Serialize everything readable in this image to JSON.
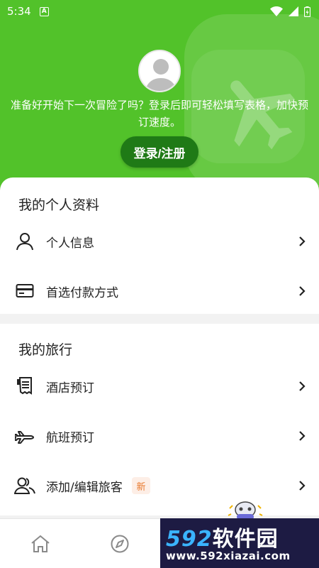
{
  "status_bar": {
    "time": "5:34",
    "notification_letter": "A"
  },
  "hero": {
    "promo_text": "准备好开始下一次冒险了吗？登录后即可轻松填写表格，加快预订速度。",
    "login_button": "登录/注册"
  },
  "profile_section": {
    "title": "我的个人资料",
    "items": [
      {
        "label": "个人信息",
        "icon": "person-icon"
      },
      {
        "label": "首选付款方式",
        "icon": "credit-card-icon"
      }
    ]
  },
  "trips_section": {
    "title": "我的旅行",
    "items": [
      {
        "label": "酒店预订",
        "icon": "receipt-icon"
      },
      {
        "label": "航班预订",
        "icon": "airplane-icon"
      },
      {
        "label": "添加/编辑旅客",
        "icon": "group-icon",
        "badge": "新"
      }
    ]
  },
  "tab_bar": {
    "items": [
      "home-icon",
      "compass-icon"
    ]
  },
  "watermark": {
    "brand_num": "592",
    "brand_text": "软件园",
    "url": "www.592xiazai.com"
  },
  "colors": {
    "primary_green": "#52c22a",
    "button_dark_green": "#1f7a16",
    "badge_orange": "#e8782c"
  }
}
